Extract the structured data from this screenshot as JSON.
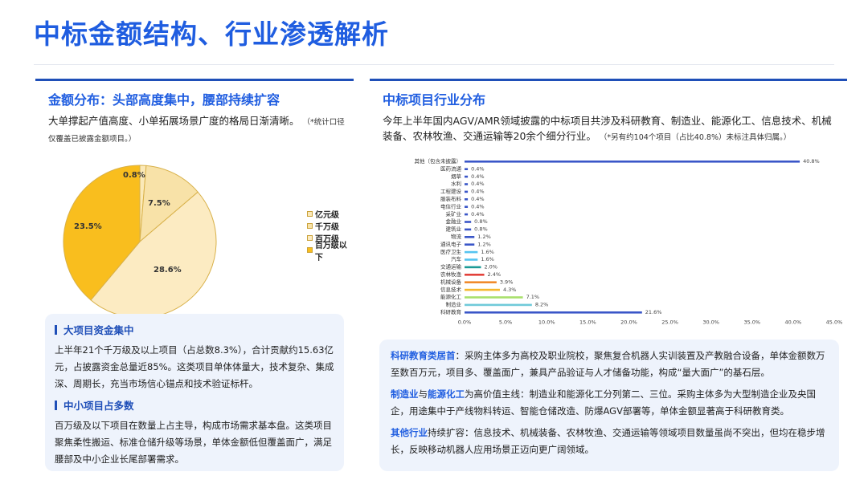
{
  "page": {
    "title": "中标金额结构、行业渗透解析"
  },
  "left": {
    "heading": "金额分布：头部高度集中，腰部持续扩容",
    "desc": "大单撑起产值高度、小单拓展场景广度的格局日渐清晰。",
    "note": "（*统计口径仅覆盖已披露金额项目。）",
    "pie_labels": [
      "0.8%",
      "7.5%",
      "23.5%",
      "28.6%"
    ],
    "legend": [
      "亿元级",
      "千万级",
      "百万级",
      "百万级以下"
    ],
    "callouts": [
      {
        "title": "大项目资金集中",
        "text": "上半年21个千万级及以上项目（占总数8.3%），合计贡献约15.63亿元，占披露资金总量近85%。这类项目单体体量大，技术复杂、集成深、周期长，充当市场信心锚点和技术验证标杆。"
      },
      {
        "title": "中小项目占多数",
        "text": "百万级及以下项目在数量上占主导，构成市场需求基本盘。这类项目聚焦柔性搬运、标准仓储升级等场景，单体金额低但覆盖面广，满足腰部及中小企业长尾部署需求。"
      }
    ]
  },
  "right": {
    "heading": "中标项目行业分布",
    "desc": "今年上半年国内AGV/AMR领域披露的中标项目共涉及科研教育、制造业、能源化工、信息技术、机械装备、农林牧渔、交通运输等20余个细分行业。",
    "note": "（*另有约104个项目（占比40.8%）未标注具体归属。）",
    "insights": [
      {
        "parts": [
          {
            "t": "科研教育类居首",
            "hl": true
          },
          {
            "t": "：采购主体多为高校及职业院校，聚焦复合机器人实训装置及产教融合设备，单体金额数万至数百万元，项目多、覆盖面广，兼具产品验证与人才储备功能，构成“量大面广”的基石层。",
            "hl": false
          }
        ]
      },
      {
        "parts": [
          {
            "t": "制造业",
            "hl": true
          },
          {
            "t": "与",
            "hl": false
          },
          {
            "t": "能源化工",
            "hl": true
          },
          {
            "t": "为高价值主线：制造业和能源化工分列第二、三位。采购主体多为大型制造企业及央国企，用途集中于产线物料转运、智能仓储改造、防爆AGV部署等，单体金额显著高于科研教育类。",
            "hl": false
          }
        ]
      },
      {
        "parts": [
          {
            "t": "其他行业",
            "hl": true
          },
          {
            "t": "持续扩容：信息技术、机械装备、农林牧渔、交通运输等领域项目数量虽尚不突出，但均在稳步增长，反映移动机器人应用场景正迈向更广阔领域。",
            "hl": false
          }
        ]
      }
    ]
  },
  "chart_data": [
    {
      "type": "pie",
      "title": "",
      "categories": [
        "亿元级",
        "千万级",
        "百万级",
        "百万级以下"
      ],
      "values": [
        0.8,
        7.5,
        28.6,
        23.5
      ],
      "data_labels": [
        "0.8%",
        "7.5%",
        "28.6%",
        "23.5%"
      ],
      "colors": [
        "#fbe9b8",
        "#f8e2a8",
        "#fcebc2",
        "#f9be1e"
      ],
      "legend_position": "right"
    },
    {
      "type": "bar",
      "orientation": "horizontal",
      "title": "",
      "categories": [
        "其他（包含未披露）",
        "医药流通",
        "烟草",
        "水利",
        "工程建设",
        "服装布料",
        "电信行业",
        "采矿业",
        "金融业",
        "建筑业",
        "物流",
        "通讯电子",
        "医疗卫生",
        "汽车",
        "交通运输",
        "农林牧渔",
        "机械设备",
        "信息技术",
        "能源化工",
        "制造业",
        "科研教育"
      ],
      "values": [
        40.8,
        0.4,
        0.4,
        0.4,
        0.4,
        0.4,
        0.4,
        0.4,
        0.8,
        0.8,
        1.2,
        1.2,
        1.6,
        1.6,
        2.0,
        2.4,
        3.9,
        4.3,
        7.1,
        8.2,
        21.6
      ],
      "data_labels": [
        "40.8%",
        "0.4%",
        "0.4%",
        "0.4%",
        "0.4%",
        "0.4%",
        "0.4%",
        "0.4%",
        "0.8%",
        "0.8%",
        "1.2%",
        "1.2%",
        "1.6%",
        "1.6%",
        "2.0%",
        "2.4%",
        "3.9%",
        "4.3%",
        "7.1%",
        "8.2%",
        "21.6%"
      ],
      "colors": [
        "#3a56c8",
        "#3a56c8",
        "#3a56c8",
        "#3a56c8",
        "#3a56c8",
        "#3a56c8",
        "#3a56c8",
        "#3a56c8",
        "#3a56c8",
        "#3a56c8",
        "#3a56c8",
        "#3a56c8",
        "#55c4f0",
        "#55c4f0",
        "#1b9b97",
        "#e2413b",
        "#f08a2c",
        "#f5b82e",
        "#a8e06a",
        "#6fcad9",
        "#3a56c8"
      ],
      "xlim": [
        0,
        45
      ],
      "x_ticks": [
        "0.0%",
        "5.0%",
        "10.0%",
        "15.0%",
        "20.0%",
        "25.0%",
        "30.0%",
        "35.0%",
        "40.0%",
        "45.0%"
      ],
      "grid": false
    }
  ]
}
